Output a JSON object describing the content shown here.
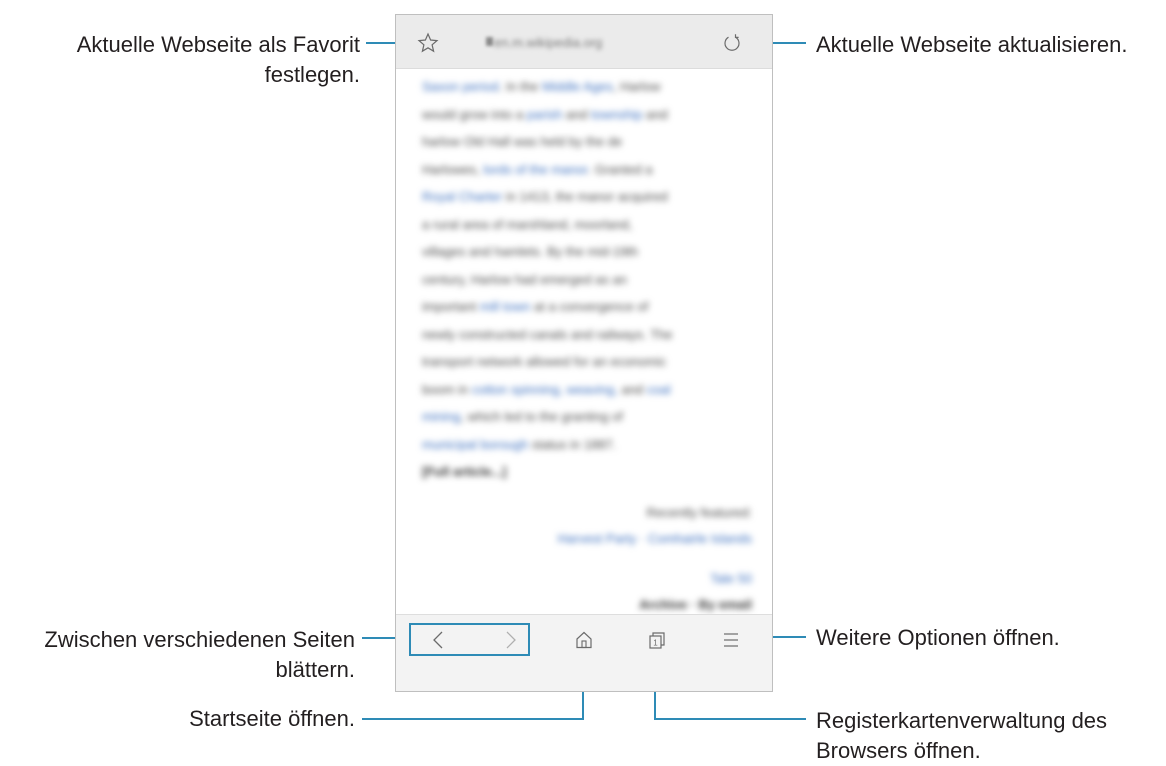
{
  "browser": {
    "url": "en.m.wikipedia.org",
    "content_lines": [
      "Saxon period. In the Middle Ages, Harlow",
      "would grow into a parish and township and",
      "harlow Old Hall was held by the de",
      "Harlowes, lords of the manor. Granted a",
      "Royal Charter in 1413, the manor acquired",
      "a rural area of marshland, moorland,",
      "villages and hamlets. By the mid-19th",
      "century, Harlow had emerged as an",
      "important mill town at a convergence of",
      "newly constructed canals and railways. The",
      "transport network allowed for an economic",
      "boom in cotton spinning, weaving, and coal",
      "mining, which led to the granting of",
      "municipal borough status in 1887.",
      "[Full article...]"
    ],
    "right_lines": [
      "Recently featured:",
      "Harvest Party · Comhairle Islands"
    ],
    "footer_lines": [
      "Tale 50",
      "Archive · By email"
    ]
  },
  "callouts": {
    "favorite": [
      "Aktuelle Webseite als Favorit",
      "festlegen."
    ],
    "refresh": "Aktuelle Webseite aktualisieren.",
    "navigate": [
      "Zwischen verschiedenen Seiten",
      "blättern."
    ],
    "home": "Startseite öffnen.",
    "more": "Weitere Optionen öffnen.",
    "tabs": [
      "Registerkartenverwaltung des",
      "Browsers öffnen."
    ]
  },
  "icons": [
    "star-icon",
    "refresh-icon",
    "back-icon",
    "forward-icon",
    "home-icon",
    "tabs-icon",
    "menu-icon"
  ],
  "colors": {
    "callout_line": "#2e8bb6",
    "link": "#3b6fbf",
    "urlbar": "#ebebeb"
  }
}
